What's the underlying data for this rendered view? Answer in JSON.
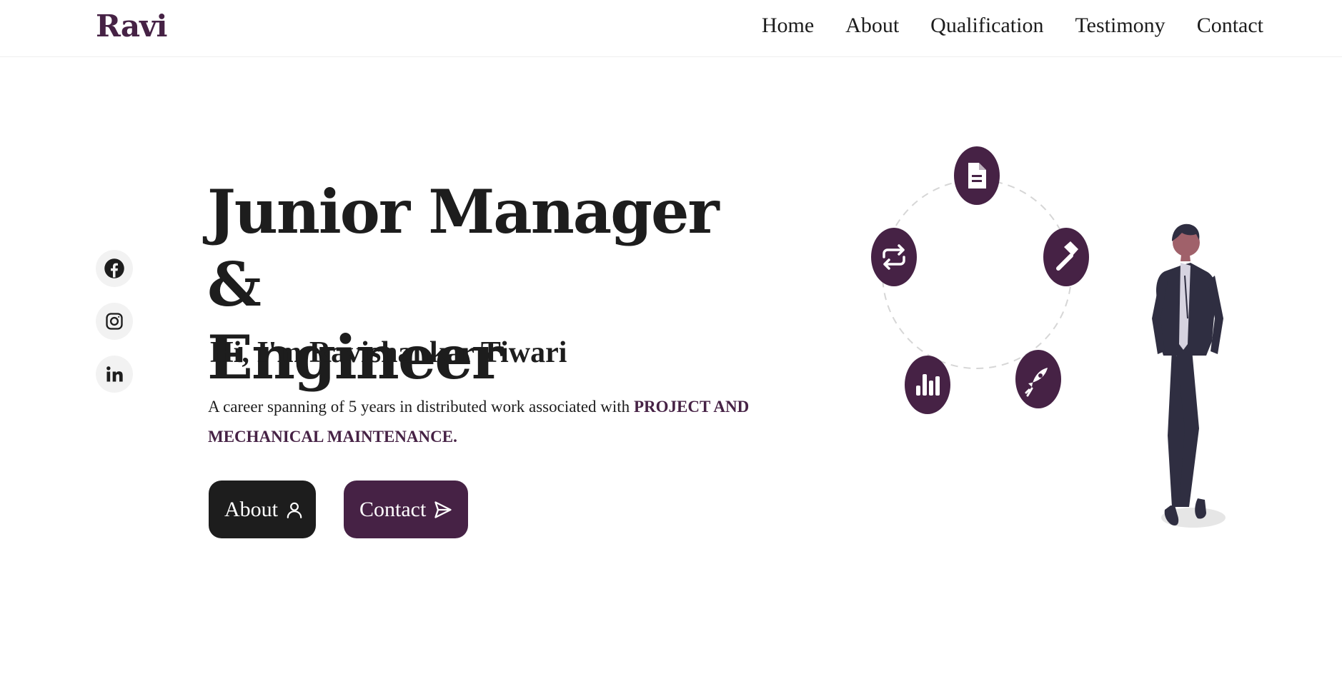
{
  "brand": {
    "logo": "Ravi",
    "accent": "#462245",
    "dark": "#1d1d1d"
  },
  "nav": {
    "items": [
      {
        "label": "Home"
      },
      {
        "label": "About"
      },
      {
        "label": "Qualification"
      },
      {
        "label": "Testimony"
      },
      {
        "label": "Contact"
      }
    ]
  },
  "social": {
    "icons": [
      "facebook-icon",
      "instagram-icon",
      "linkedin-icon"
    ]
  },
  "hero": {
    "title_line1": "Junior Manager &",
    "title_line2": "Engineer",
    "greeting": "Hi, I'm Ravishankar Tiwari",
    "description": "A career spanning of 5 years in distributed work associated with",
    "highlight": "PROJECT AND MECHANICAL MAINTENANCE."
  },
  "buttons": {
    "about_label": "About",
    "contact_label": "Contact"
  },
  "illustration": {
    "icons": [
      "document-icon",
      "hammer-icon",
      "rocket-icon",
      "bar-chart-icon",
      "repeat-icon"
    ]
  }
}
